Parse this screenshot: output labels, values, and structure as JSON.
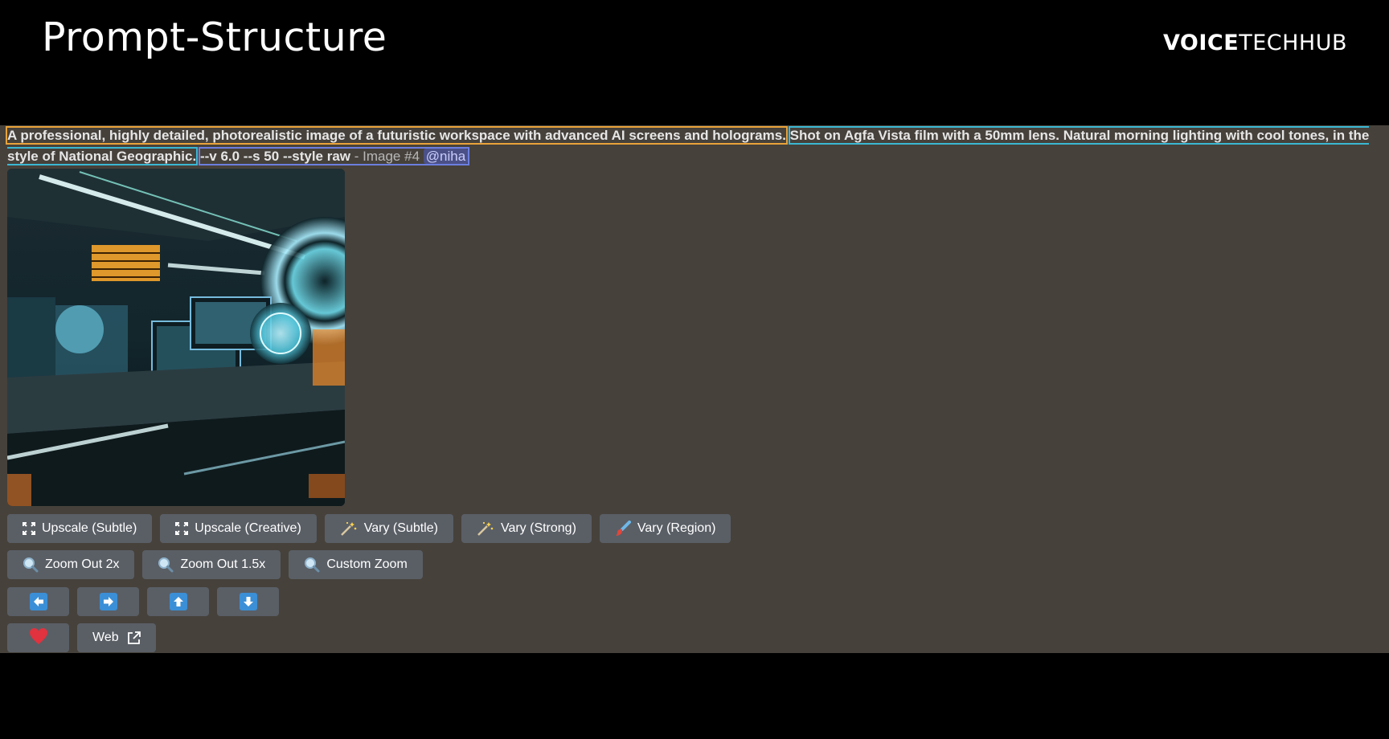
{
  "header": {
    "title": "Prompt-Structure",
    "brand_bold": "VOICE",
    "brand_regular": "TECHHUB"
  },
  "prompt": {
    "subject": "A professional, highly detailed, photorealistic image of a futuristic workspace with advanced AI screens and holograms.",
    "style": "Shot on Agfa Vista film with a 50mm lens. Natural morning lighting with cool tones, in the style of National Geographic.",
    "params": "--v 6.0 --s 50 --style raw",
    "meta": " - Image #4 ",
    "mention": "@niha"
  },
  "colors": {
    "subject_outline": "#e9a23a",
    "style_outline": "#3ab7d3",
    "params_outline": "#6c7ee0",
    "panel_bg": "#46413b",
    "button_bg": "#5a5f66",
    "arrow_blue": "#3b8fd6",
    "heart_red": "#e0323f"
  },
  "buttons": {
    "row1": [
      {
        "label": "Upscale (Subtle)",
        "icon": "expand-icon"
      },
      {
        "label": "Upscale (Creative)",
        "icon": "expand-icon"
      },
      {
        "label": "Vary (Subtle)",
        "icon": "magic-wand-icon"
      },
      {
        "label": "Vary (Strong)",
        "icon": "magic-wand-icon"
      },
      {
        "label": "Vary (Region)",
        "icon": "paintbrush-icon"
      }
    ],
    "row2": [
      {
        "label": "Zoom Out 2x",
        "icon": "magnifier-icon"
      },
      {
        "label": "Zoom Out 1.5x",
        "icon": "magnifier-icon"
      },
      {
        "label": "Custom Zoom",
        "icon": "magnifier-icon"
      }
    ],
    "row3": [
      "arrow-left-icon",
      "arrow-right-icon",
      "arrow-up-icon",
      "arrow-down-icon"
    ],
    "row4": {
      "web_label": "Web"
    }
  }
}
